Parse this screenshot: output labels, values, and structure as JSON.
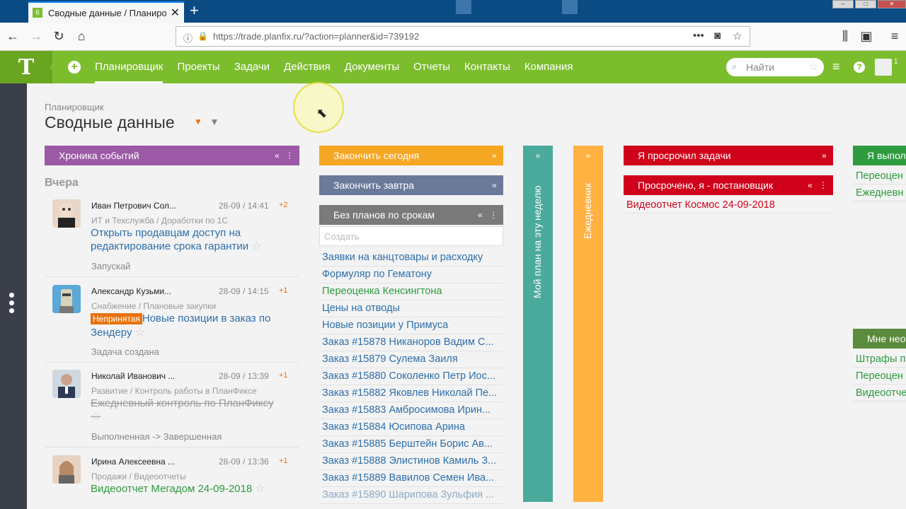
{
  "browser": {
    "tab_title": "Сводные данные / Планировщ",
    "tab_favicon": "6",
    "url": "https://trade.planfix.ru/?action=planner&id=739192"
  },
  "header": {
    "logo": "T",
    "nav": [
      "Планировщик",
      "Проекты",
      "Задачи",
      "Действия",
      "Документы",
      "Отчеты",
      "Контакты",
      "Компания"
    ],
    "search_placeholder": "Найти",
    "user_count": "1"
  },
  "page": {
    "breadcrumb": "Планировщик",
    "title": "Сводные данные"
  },
  "columns": {
    "chronicle": "Хроника событий",
    "finish_today": "Закончить сегодня",
    "finish_tomorrow": "Закончить завтра",
    "no_plans": "Без планов по срокам",
    "my_week_plan": "Мой план на эту неделю",
    "daily": "Ежедневник",
    "i_overdue": "Я просрочил задачи",
    "overdue_setter": "Просрочено, я - постановщик",
    "i_did": "Я выпол",
    "to_me": "Мне нео"
  },
  "feed": {
    "day_label": "Вчера",
    "items": [
      {
        "author": "Иван Петрович Сол...",
        "time": "28-09 / 14:41",
        "count": "+2",
        "path": "ИТ и Техслужба / Доработки по 1С",
        "task": "Открыть продавцам доступ на редактирование срока гарантии",
        "status": "Запускай"
      },
      {
        "author": "Александр Кузьми...",
        "time": "28-09 / 14:15",
        "count": "+1",
        "path": "Снабжение / Плановые закупки",
        "badge": "Непринятая",
        "task": "Новые позиции в заказ по Зендеру",
        "status": "Задача создана"
      },
      {
        "author": "Николай Иванович ...",
        "time": "28-09 / 13:39",
        "count": "+1",
        "path": "Развитие / Контроль работы в ПланФиксе",
        "task": "Ежедневный контроль по ПланФиксу",
        "status": "Выполненная -> Завершенная"
      },
      {
        "author": "Ирина Алексеевна ...",
        "time": "28-09 / 13:36",
        "count": "+1",
        "path": "Продажи / Видеоотчеты",
        "task": "Видеоотчет Мегадом 24-09-2018"
      }
    ]
  },
  "create_placeholder": "Создать",
  "tasks": [
    "Заявки на канцтовары и расходку",
    "Формуляр по Гематону",
    "Переоценка Кенсингтона",
    "Цены на отводы",
    "Новые позиции у Примуса",
    "Заказ #15878 Никаноров Вадим С...",
    "Заказ #15879 Сулема Заиля",
    "Заказ #15880 Соколенко Петр Иос...",
    "Заказ #15882 Яковлев Николай Пе...",
    "Заказ #15883 Амбросимова Ирин...",
    "Заказ #15884 Юсипова Арина",
    "Заказ #15885 Берштейн Борис Ав...",
    "Заказ #15888 Элистинов Камиль З...",
    "Заказ #15889 Вавилов Семен Ива...",
    "Заказ #15890 Шарипова Зульфия ..."
  ],
  "overdue_items": [
    "Видеоотчет Космос 24-09-2018"
  ],
  "right_items_top": [
    "Переоцен",
    "Ежедневн"
  ],
  "right_items_bottom": [
    "Штрафы п",
    "Переоцен",
    "Видеоотче"
  ],
  "colors": {
    "brand_green": "#7cbd2e",
    "chronicle": "#9b59a6",
    "finish_today": "#f5a623",
    "finish_tomorrow": "#6b7a99",
    "no_plans": "#7a7a7a",
    "week_plan": "#4aaa9c",
    "daily": "#ffb142",
    "overdue": "#d0021b",
    "did": "#2e9b3f",
    "to_me": "#5b8c3e"
  }
}
